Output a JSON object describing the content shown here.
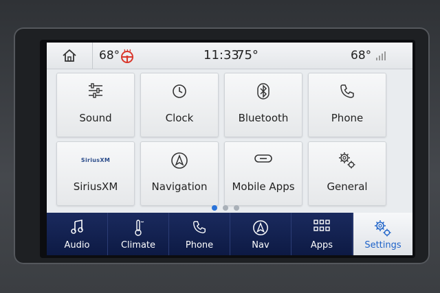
{
  "status_bar": {
    "temp_left": "68°",
    "time": "11:33",
    "temp_outside": "75°",
    "temp_right": "68°"
  },
  "tiles": [
    {
      "label": "Sound",
      "icon": "equalizer-icon"
    },
    {
      "label": "Clock",
      "icon": "clock-icon"
    },
    {
      "label": "Bluetooth",
      "icon": "bluetooth-icon"
    },
    {
      "label": "Phone",
      "icon": "phone-icon"
    },
    {
      "label": "SiriusXM",
      "icon": "siriusxm-logo",
      "logo_text": "SiriusXM"
    },
    {
      "label": "Navigation",
      "icon": "navigation-arrow-icon"
    },
    {
      "label": "Mobile Apps",
      "icon": "link-icon"
    },
    {
      "label": "General",
      "icon": "gears-icon"
    }
  ],
  "pagination": {
    "pages": 3,
    "current": 1
  },
  "nav": [
    {
      "label": "Audio",
      "icon": "music-note-icon"
    },
    {
      "label": "Climate",
      "icon": "thermometer-icon"
    },
    {
      "label": "Phone",
      "icon": "phone-icon"
    },
    {
      "label": "Nav",
      "icon": "navigation-arrow-icon"
    },
    {
      "label": "Apps",
      "icon": "grid-icon"
    },
    {
      "label": "Settings",
      "icon": "gears-icon",
      "active": true
    }
  ],
  "colors": {
    "nav_background": "#0d1a44",
    "active_accent": "#1e63c9",
    "dot_active": "#2a73d9",
    "heated_wheel": "#d9362b"
  }
}
